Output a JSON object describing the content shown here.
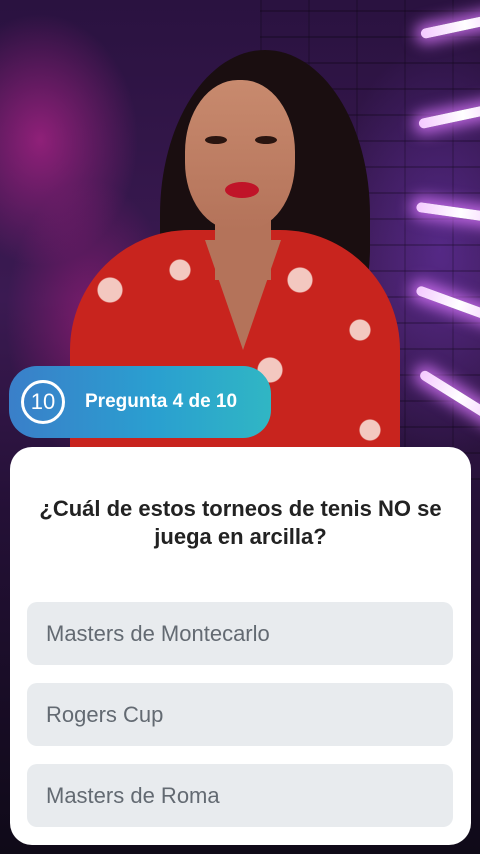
{
  "quiz": {
    "timer_value": "10",
    "progress_label": "Pregunta 4 de 10",
    "question": "¿Cuál de estos torneos de tenis NO se juega en arcilla?",
    "options": [
      {
        "label": "Masters de Montecarlo"
      },
      {
        "label": "Rogers Cup"
      },
      {
        "label": "Masters de Roma"
      }
    ]
  },
  "colors": {
    "badge_gradient_start": "#3a7fc9",
    "badge_gradient_end": "#30b6c4",
    "option_background": "#e8ebee",
    "option_text": "#636a72",
    "question_text": "#222222"
  },
  "icons": {
    "timer": "countdown-ring-icon"
  }
}
